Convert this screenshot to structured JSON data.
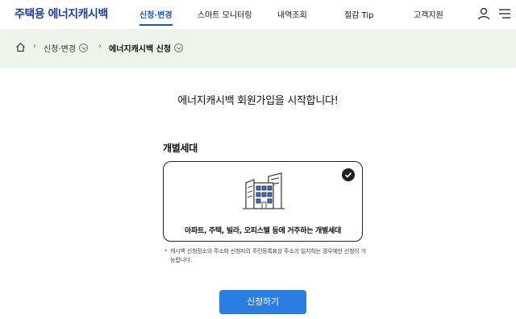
{
  "header": {
    "logo": "주택용 에너지캐시백",
    "nav": [
      {
        "label": "신청·변경",
        "active": true
      },
      {
        "label": "스마트 모니터링",
        "active": false
      },
      {
        "label": "내역조회",
        "active": false
      },
      {
        "label": "절감 Tip",
        "active": false
      },
      {
        "label": "고객지원",
        "active": false
      }
    ],
    "icons": [
      "user-icon",
      "menu-icon"
    ]
  },
  "breadcrumb": {
    "home_icon": "home-icon",
    "level1": "신청·변경",
    "level2": "에너지캐시백 신청"
  },
  "main": {
    "title": "에너지캐시백 회원가입을 시작합니다!",
    "section_label": "개별세대",
    "card": {
      "text": "아파트, 주택, 빌라, 오피스텔 등에 거주하는 개별세대",
      "selected": true,
      "icon": "building-icon"
    },
    "notice": "* 캐시백 신청장소의 주소와 신청자의 주민등록표상 주소가 일치하는 경우에만 신청이 가능합니다.",
    "notice_star": "*",
    "notice_text": "캐시백 신청장소의 주소와 신청자의 주민등록표상 주소가 일치하는 경우에만 신청이 가능합니다.",
    "apply_button": "신청하기"
  },
  "colors": {
    "brand": "#1f3f9e",
    "accent": "#1a56c8",
    "crumb_bg": "#eef4ea",
    "button": "#2a7de1"
  }
}
